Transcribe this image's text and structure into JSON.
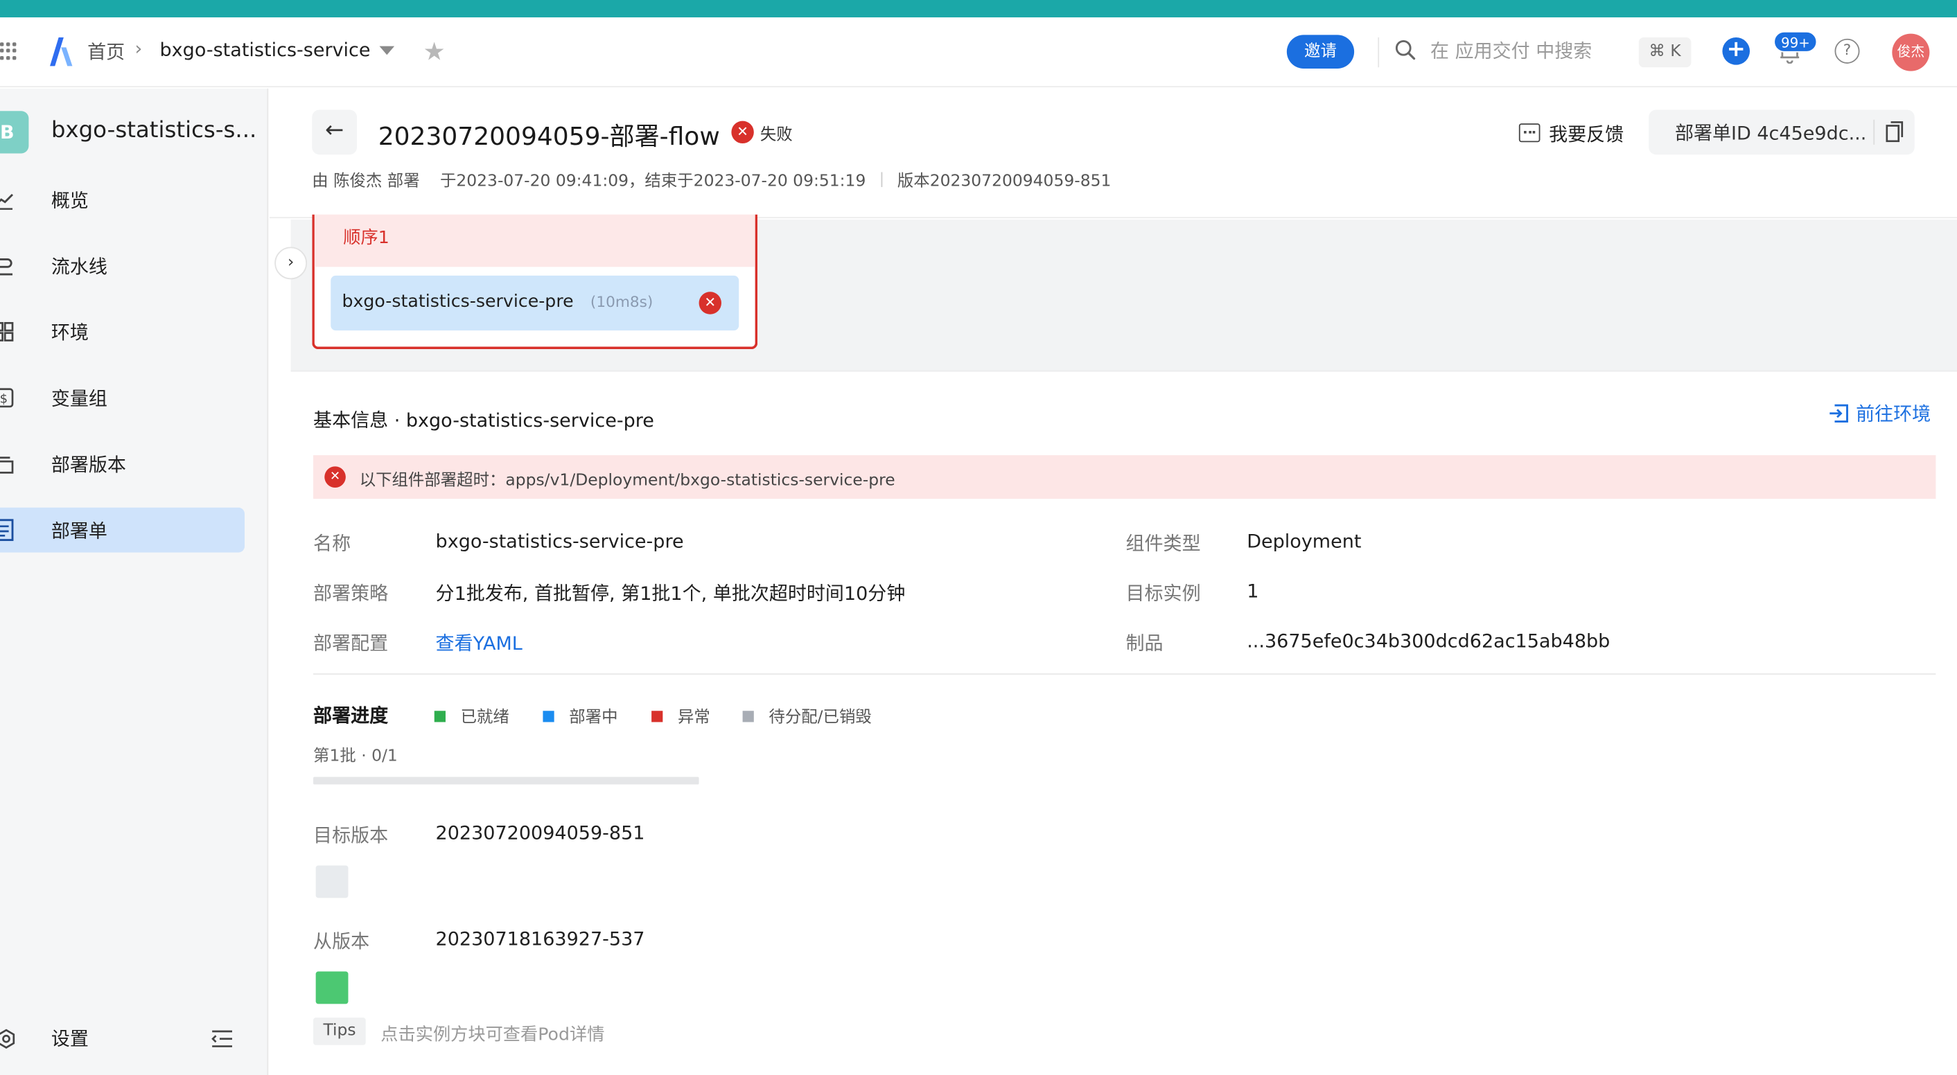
{
  "header": {
    "breadcrumb_home": "首页",
    "breadcrumb_app": "bxgo-statistics-service",
    "invite_label": "邀请",
    "search_placeholder": "在 应用交付 中搜索",
    "shortcut": "⌘ K",
    "notification_count": "99+",
    "avatar_text": "俊杰",
    "icons": [
      "grid-icon",
      "logo-icon",
      "chevron-right-icon",
      "chevron-down-icon",
      "star-icon",
      "search-icon",
      "plus-icon",
      "bell-icon",
      "help-icon"
    ]
  },
  "sidebar": {
    "app_initial": "B",
    "app_name": "bxgo-statistics-s...",
    "items": [
      {
        "label": "概览",
        "icon": "chart-line-icon"
      },
      {
        "label": "流水线",
        "icon": "pipeline-icon"
      },
      {
        "label": "环境",
        "icon": "grid-blocks-icon"
      },
      {
        "label": "变量组",
        "icon": "dollar-icon"
      },
      {
        "label": "部署版本",
        "icon": "stack-icon"
      },
      {
        "label": "部署单",
        "icon": "document-icon",
        "active": true
      }
    ],
    "settings_label": "设置"
  },
  "page": {
    "title": "20230720094059-部署-flow",
    "status": "失败",
    "feedback_label": "我要反馈",
    "deploy_id": "部署单ID 4c45e9dc...",
    "meta_user": "由 陈俊杰 部署",
    "meta_time": "于2023-07-20 09:41:09，结束于2023-07-20 09:51:19",
    "meta_version": "版本20230720094059-851"
  },
  "stage": {
    "name": "顺序1",
    "job_name": "bxgo-statistics-service-pre",
    "job_duration": "(10m8s)"
  },
  "info": {
    "section_title": "基本信息 · bxgo-statistics-service-pre",
    "goto_env": "前往环境",
    "alert": "以下组件部署超时：apps/v1/Deployment/bxgo-statistics-service-pre",
    "name_label": "名称",
    "name_value": "bxgo-statistics-service-pre",
    "type_label": "组件类型",
    "type_value": "Deployment",
    "strategy_label": "部署策略",
    "strategy_value": "分1批发布, 首批暂停, 第1批1个, 单批次超时时间10分钟",
    "target_instances_label": "目标实例",
    "target_instances_value": "1",
    "config_label": "部署配置",
    "config_link": "查看YAML",
    "artifact_label": "制品",
    "artifact_value": "...3675efe0c34b300dcd62ac15ab48bb"
  },
  "progress": {
    "title": "部署进度",
    "legend": [
      {
        "label": "已就绪",
        "color": "#2fae4e"
      },
      {
        "label": "部署中",
        "color": "#1b8cf0"
      },
      {
        "label": "异常",
        "color": "#d8312b"
      },
      {
        "label": "待分配/已销毁",
        "color": "#a8adb5"
      }
    ],
    "batch_label": "第1批 · 0/1",
    "fraction": 0,
    "target_version_label": "目标版本",
    "target_version": "20230720094059-851",
    "target_instance_color": "#e8ebee",
    "from_version_label": "从版本",
    "from_version": "20230718163927-537",
    "from_instance_color": "#4cc872",
    "tips_tag": "Tips",
    "tips_text": "点击实例方块可查看Pod详情"
  }
}
